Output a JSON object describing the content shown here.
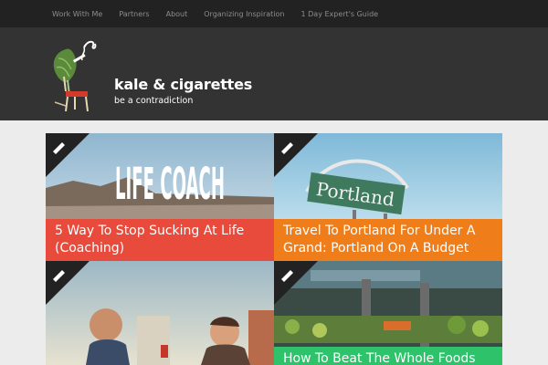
{
  "nav": {
    "items": [
      "Work With Me",
      "Partners",
      "About",
      "Organizing Inspiration",
      "1 Day Expert's Guide"
    ]
  },
  "header": {
    "title": "kale & cigarettes",
    "tagline": "be a contradiction"
  },
  "posts": [
    {
      "title": "5 Way To Stop Sucking At Life (Coaching)",
      "image_text": "LIFE COACH",
      "caption_color": "#e84b3c",
      "icon": "pencil-icon"
    },
    {
      "title": "Travel To Portland For Under A Grand: Portland On A Budget",
      "image_text": "Portland",
      "caption_color": "#ef7e1a",
      "icon": "pencil-icon"
    },
    {
      "title": "",
      "caption_color": "",
      "icon": "pencil-icon"
    },
    {
      "title": "How To Beat The Whole Foods",
      "caption_color": "#2ec36b",
      "icon": "pencil-icon"
    }
  ]
}
